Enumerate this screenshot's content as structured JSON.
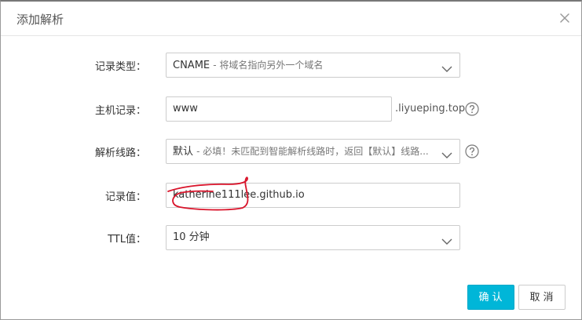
{
  "dialog": {
    "title": "添加解析"
  },
  "form": {
    "record_type": {
      "label": "记录类型：",
      "value": "CNAME",
      "hint": "- 将域名指向另外一个域名"
    },
    "host": {
      "label": "主机记录：",
      "value": "www",
      "suffix": ".liyueping.top"
    },
    "line": {
      "label": "解析线路：",
      "value": "默认",
      "hint": "- 必填！未匹配到智能解析线路时，返回【默认】线路..."
    },
    "record_value": {
      "label": "记录值：",
      "value": "katherine111lee.github.io"
    },
    "ttl": {
      "label": "TTL值：",
      "value": "10 分钟"
    }
  },
  "buttons": {
    "ok": "确认",
    "cancel": "取消"
  },
  "colors": {
    "primary": "#00b6d8",
    "annotation": "#d9142b"
  },
  "icons": {
    "close": "close-icon",
    "dropdown": "chevron-down-icon",
    "help": "help-icon"
  }
}
